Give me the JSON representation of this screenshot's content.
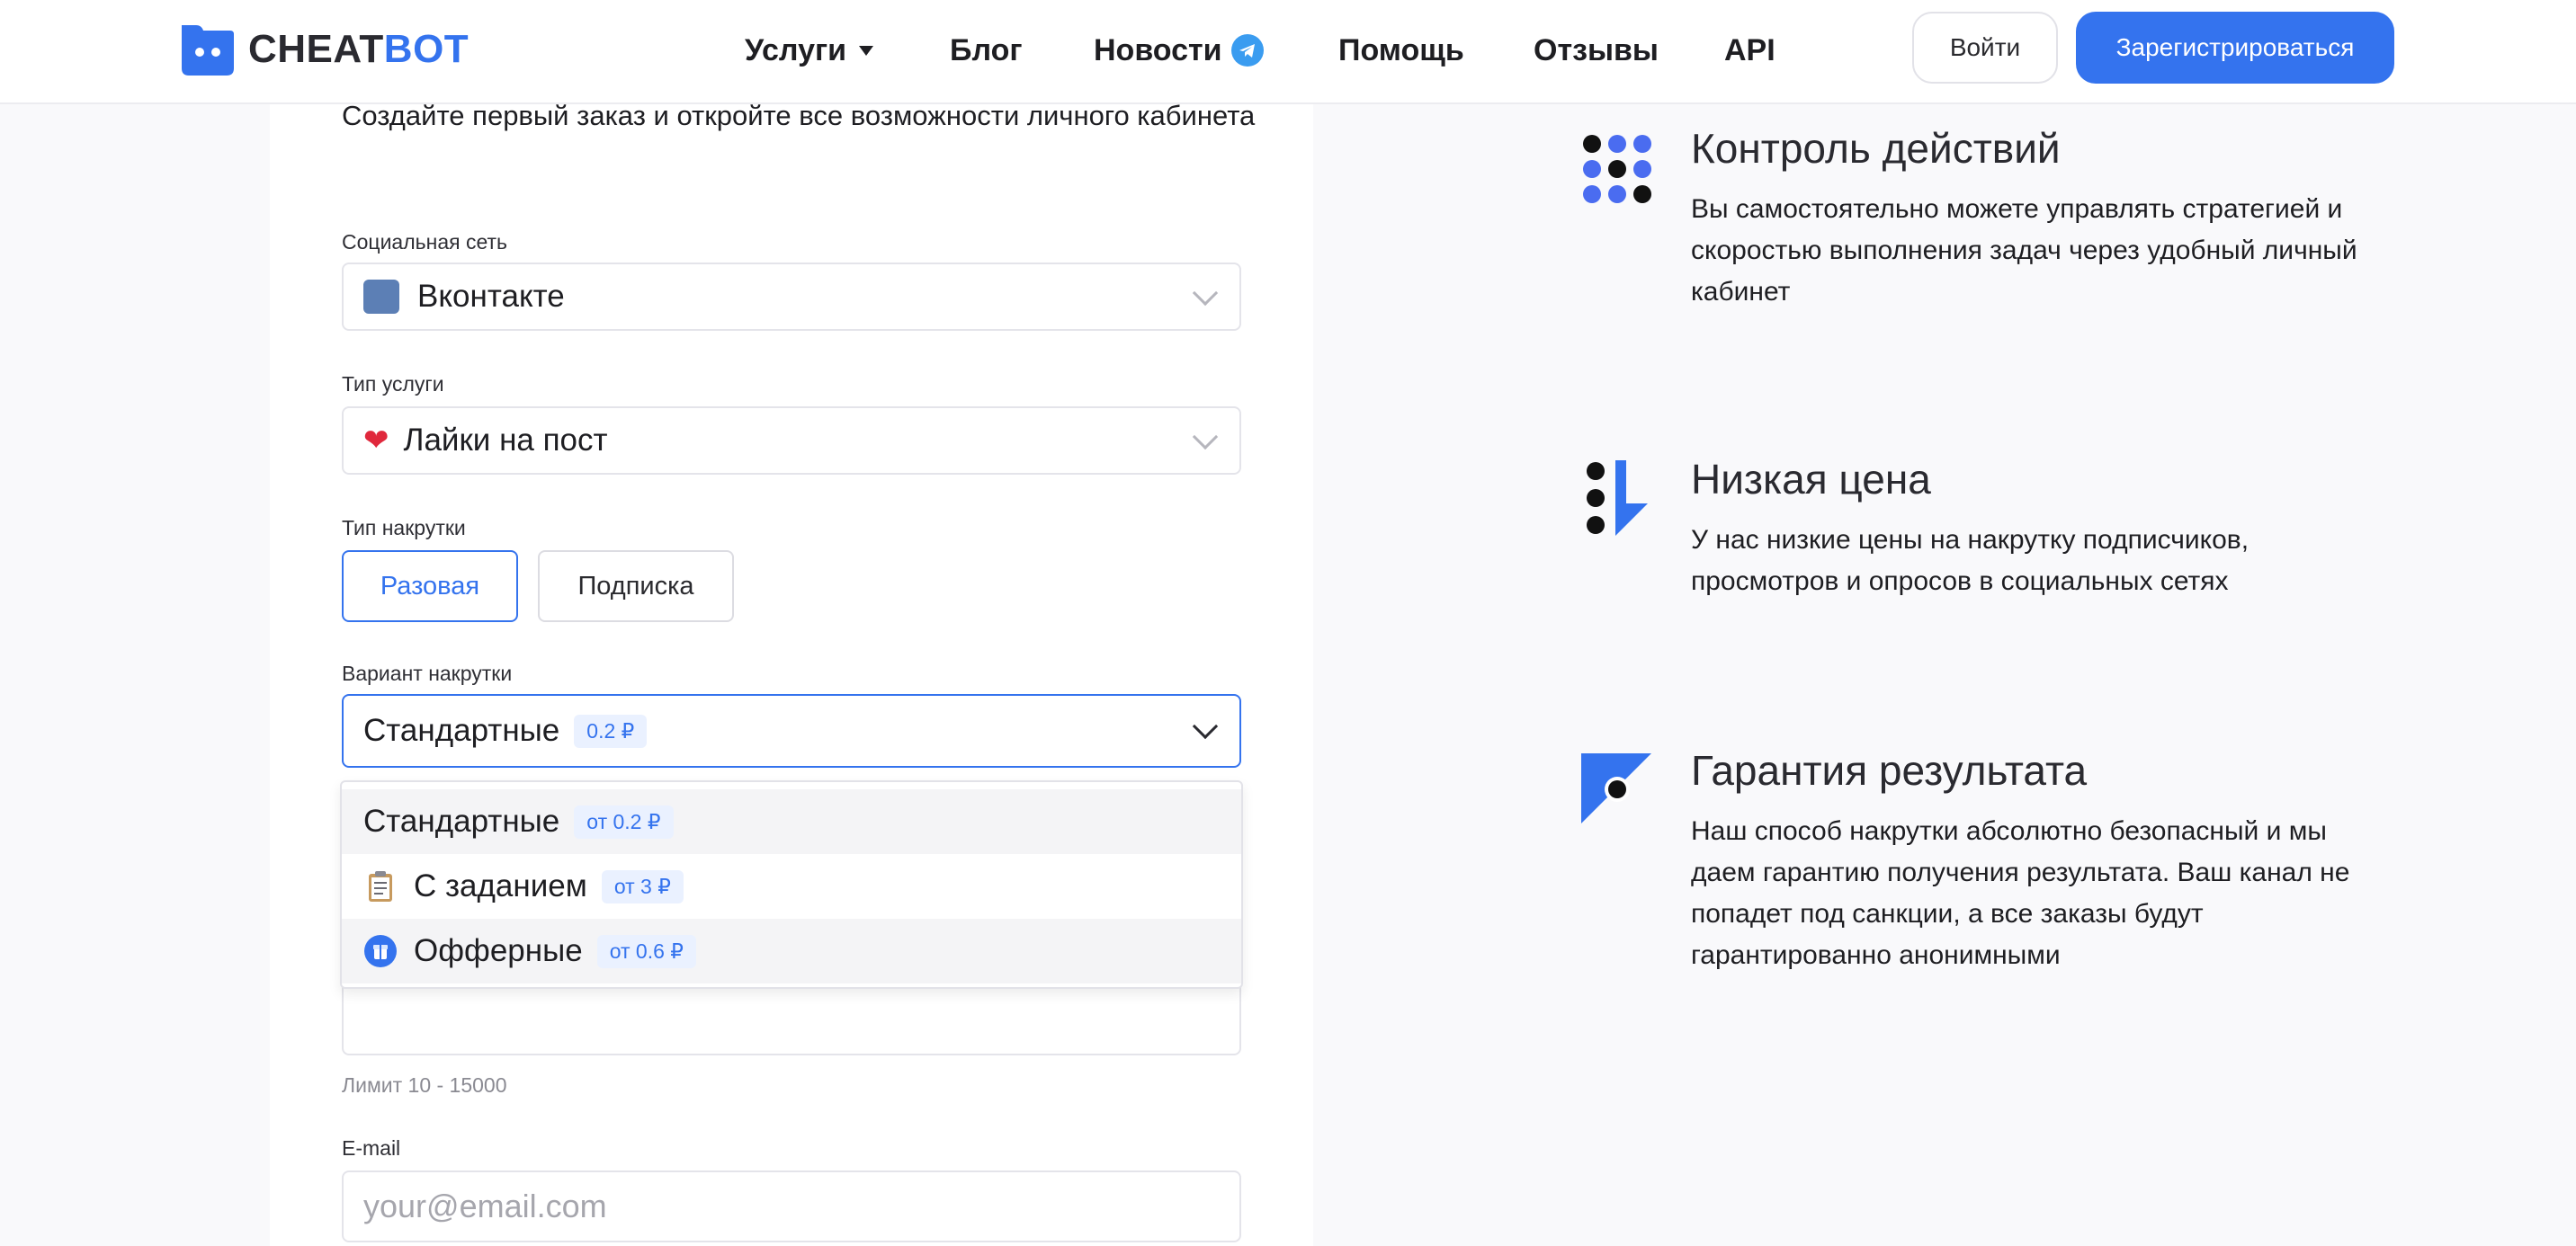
{
  "header": {
    "logo": {
      "part1": "CHEAT",
      "part2": "BOT"
    },
    "nav": [
      {
        "label": "Услуги",
        "has_caret": true
      },
      {
        "label": "Блог"
      },
      {
        "label": "Новости",
        "icon": "telegram-icon"
      },
      {
        "label": "Помощь"
      },
      {
        "label": "Отзывы"
      },
      {
        "label": "API"
      }
    ],
    "login_label": "Войти",
    "register_label": "Зарегистрироваться"
  },
  "form": {
    "intro": "Создайте первый заказ и откройте все возможности личного кабинета",
    "social": {
      "label": "Социальная сеть",
      "value": "Вконтакте",
      "icon": "vk-square-icon"
    },
    "service": {
      "label": "Тип услуги",
      "value": "Лайки на пост",
      "icon": "heart-icon"
    },
    "boost_type": {
      "label": "Тип накрутки",
      "options": [
        "Разовая",
        "Подписка"
      ],
      "selected": "Разовая"
    },
    "variant": {
      "label": "Вариант накрутки",
      "value": "Стандартные",
      "price": "0.2 ₽",
      "options": [
        {
          "label": "Стандартные",
          "price": "от 0.2 ₽",
          "icon": ""
        },
        {
          "label": "С заданием",
          "price": "от 3 ₽",
          "icon": "clipboard-icon"
        },
        {
          "label": "Офферные",
          "price": "от 0.6 ₽",
          "icon": "offer-icon"
        }
      ]
    },
    "limit_hint": "Лимит 10 - 15000",
    "email": {
      "label": "E-mail",
      "placeholder": "your@email.com"
    }
  },
  "features": [
    {
      "title": "Контроль действий",
      "text": "Вы самостоятельно можете управлять стратегией и скоростью выполнения задач через удобный личный кабинет"
    },
    {
      "title": "Низкая цена",
      "text": "У нас низкие цены на накрутку подписчиков, просмотров и опросов в социальных сетях"
    },
    {
      "title": "Гарантия результата",
      "text": "Наш способ накрутки абсолютно безопасный и мы даем гарантию получения результата. Ваш канал не попадет под санкции, а все заказы будут гарантированно анонимными"
    }
  ],
  "colors": {
    "accent": "#3473ee",
    "text": "#1e1e22",
    "vk": "#5c7fb5",
    "heart": "#e0283c"
  }
}
